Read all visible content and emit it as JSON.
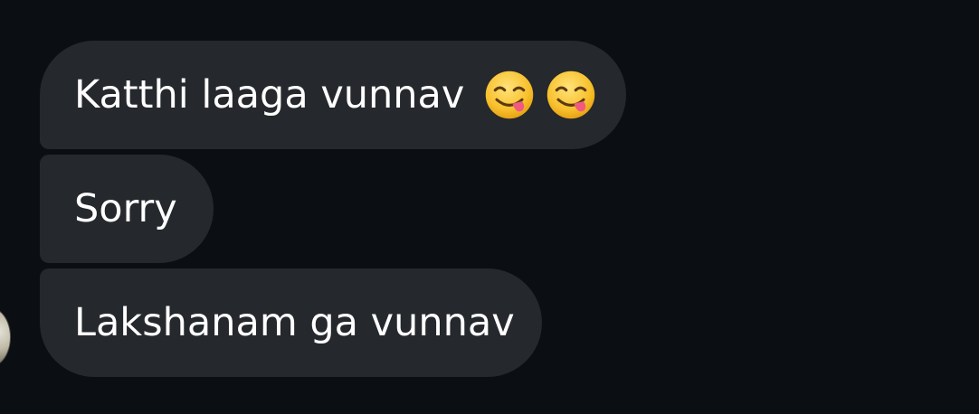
{
  "messages": [
    {
      "text": "Katthi laaga vunnav",
      "emojis": [
        "face-savoring-food-icon",
        "face-savoring-food-icon"
      ]
    },
    {
      "text": "Sorry",
      "emojis": []
    },
    {
      "text": "Lakshanam ga vunnav",
      "emojis": []
    }
  ],
  "colors": {
    "background": "#0b0f13",
    "bubble": "#25282c",
    "text": "#ffffff"
  }
}
